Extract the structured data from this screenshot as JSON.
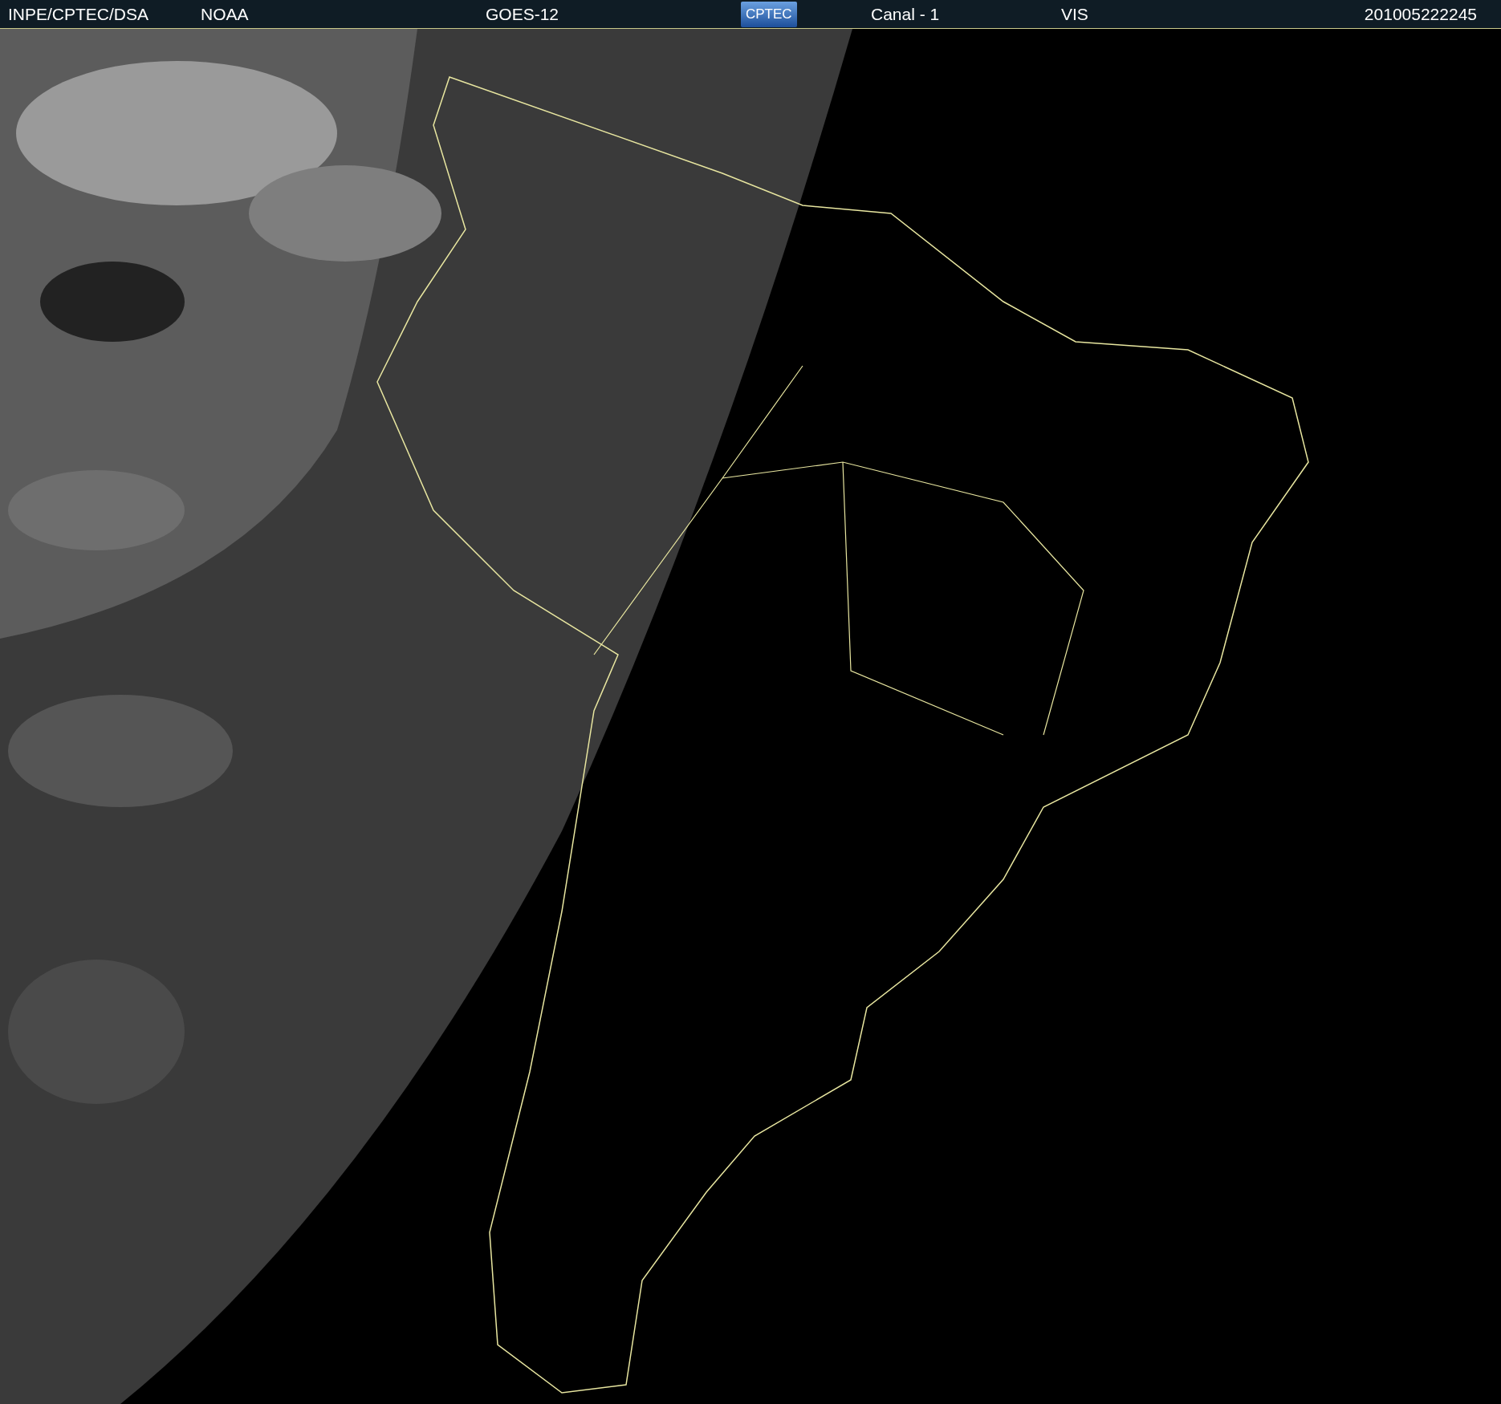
{
  "header": {
    "items": [
      {
        "kind": "text",
        "text": "INPE/CPTEC/DSA"
      },
      {
        "kind": "text",
        "text": "NOAA"
      },
      {
        "kind": "text",
        "text": "GOES-12"
      },
      {
        "kind": "logo",
        "text": "CPTEC"
      },
      {
        "kind": "text",
        "text": "Canal - 1"
      },
      {
        "kind": "text",
        "text": "VIS"
      },
      {
        "kind": "text",
        "text": "201005222245"
      }
    ]
  }
}
